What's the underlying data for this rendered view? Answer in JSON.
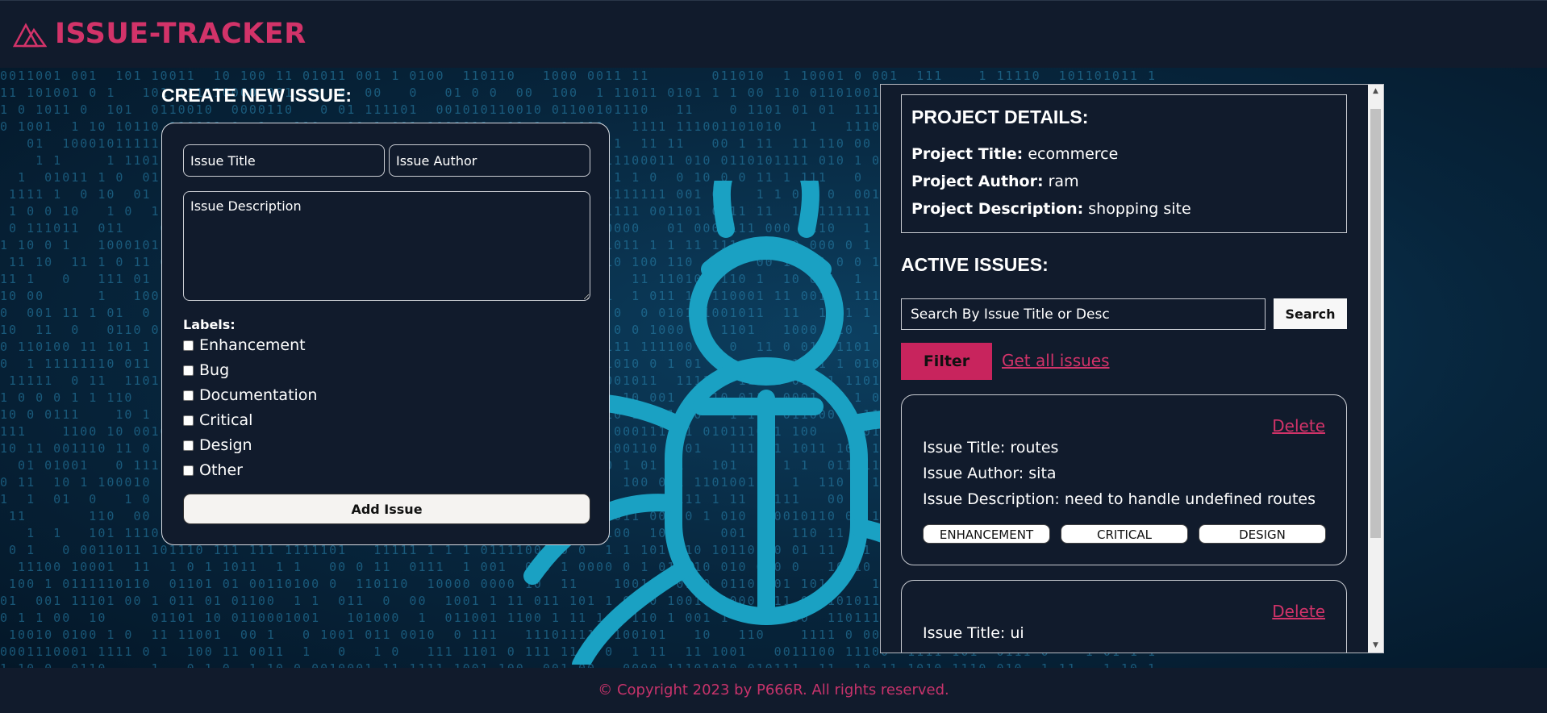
{
  "header": {
    "brand": "ISSUE-TRACKER",
    "logo_icon": "triangle-logo-icon",
    "brand_color": "#d23369"
  },
  "create": {
    "title": "CREATE NEW ISSUE:",
    "title_placeholder": "Issue Title",
    "author_placeholder": "Issue Author",
    "description_placeholder": "Issue Description",
    "labels_title": "Labels:",
    "labels": [
      "Enhancement",
      "Bug",
      "Documentation",
      "Critical",
      "Design",
      "Other"
    ],
    "add_button": "Add Issue"
  },
  "project": {
    "title": "PROJECT DETAILS:",
    "rows": [
      {
        "label": "Project Title:",
        "value": "ecommerce"
      },
      {
        "label": "Project Author:",
        "value": "ram"
      },
      {
        "label": "Project Description:",
        "value": "shopping site"
      }
    ]
  },
  "active": {
    "title": "ACTIVE ISSUES:",
    "search_placeholder": "Search By Issue Title or Desc",
    "search_button": "Search",
    "filter_button": "Filter",
    "all_link": "Get all issues",
    "accent_color": "#c8245d"
  },
  "issues": [
    {
      "delete": "Delete",
      "title_label": "Issue Title:",
      "title": "routes",
      "author_label": "Issue Author:",
      "author": "sita",
      "desc_label": "Issue Description:",
      "desc": "need to handle undefined routes",
      "tags": [
        "ENHANCEMENT",
        "CRITICAL",
        "DESIGN"
      ]
    },
    {
      "delete": "Delete",
      "title_label": "Issue Title:",
      "title": "ui"
    }
  ],
  "footer": {
    "text": "© Copyright 2023 by P666R.  All rights reserved."
  }
}
